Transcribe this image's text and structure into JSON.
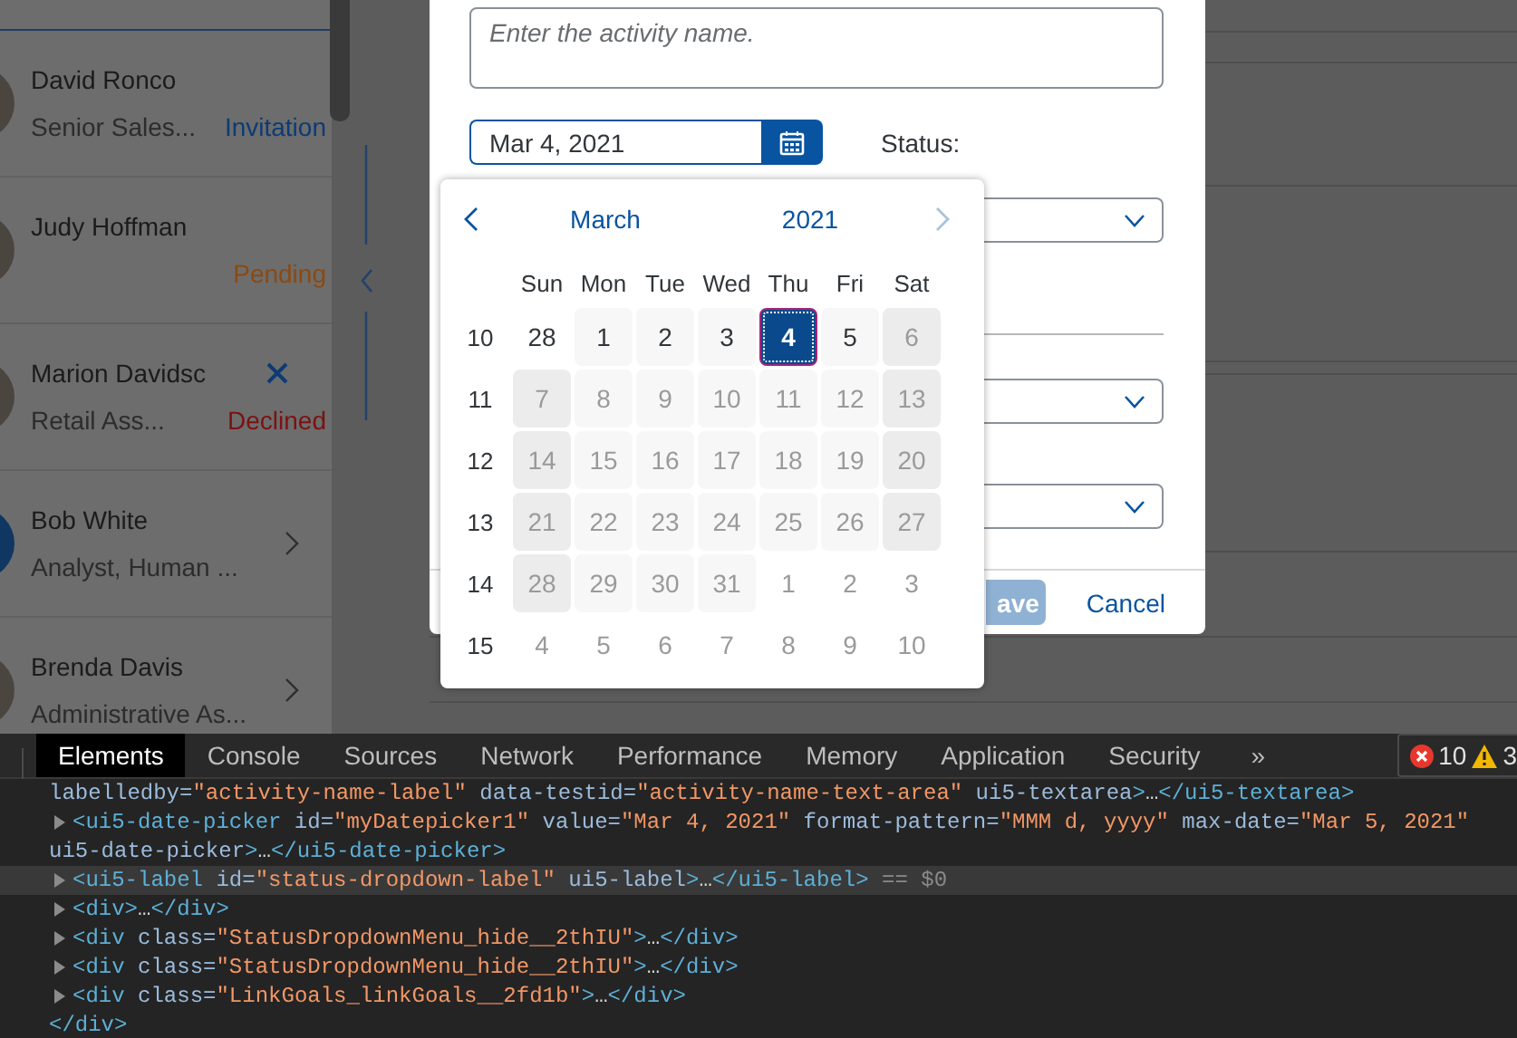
{
  "contacts": [
    {
      "name": "David Ronco",
      "subtitle": "Senior Sales...",
      "kind": "photo",
      "trailing": {
        "kind": "status",
        "text": "Invitation",
        "color": "#0d3b73"
      }
    },
    {
      "name": "Judy Hoffman",
      "kind": "photo",
      "trailing": {
        "kind": "status",
        "text": "Pending",
        "color": "#8a4a12"
      }
    },
    {
      "name": "Marion Davidsc",
      "subtitle": "Retail Ass...",
      "kind": "photo",
      "trailing": {
        "kind": "removable",
        "text": "Declined",
        "color": "#7c1111"
      }
    },
    {
      "name": "Bob White",
      "subtitle": "Analyst, Human ...",
      "kind": "plain",
      "trailing": {
        "kind": "chevron"
      }
    },
    {
      "name": "Brenda Davis",
      "subtitle": "Administrative As...",
      "kind": "photo",
      "trailing": {
        "kind": "chevron"
      }
    }
  ],
  "dialog": {
    "activity_name": {
      "placeholder": "Enter the activity name."
    },
    "date": {
      "value": "Mar 4, 2021"
    },
    "status_label": "Status:",
    "buttons": [
      {
        "label": "ave",
        "kind": "emphasized",
        "disabled": true
      },
      {
        "label": "Cancel",
        "kind": "transparent",
        "disabled": false
      }
    ]
  },
  "calendar": {
    "month": "March",
    "year": "2021",
    "prev_disabled": false,
    "next_disabled": true,
    "weekdays": [
      "Sun",
      "Mon",
      "Tue",
      "Wed",
      "Thu",
      "Fri",
      "Sat"
    ],
    "weeks": [
      {
        "number": "10",
        "days": [
          {
            "text": "28",
            "kind": "other_month",
            "disabled": false,
            "selected": false
          },
          {
            "text": "1",
            "kind": "weekday",
            "disabled": false,
            "selected": false
          },
          {
            "text": "2",
            "kind": "weekday",
            "disabled": false,
            "selected": false
          },
          {
            "text": "3",
            "kind": "weekday",
            "disabled": false,
            "selected": false
          },
          {
            "text": "4",
            "kind": "weekday",
            "disabled": false,
            "selected": true
          },
          {
            "text": "5",
            "kind": "weekday",
            "disabled": false,
            "selected": false
          },
          {
            "text": "6",
            "kind": "weekend",
            "disabled": true,
            "selected": false
          }
        ]
      },
      {
        "number": "11",
        "days": [
          {
            "text": "7",
            "kind": "weekend",
            "disabled": true,
            "selected": false
          },
          {
            "text": "8",
            "kind": "weekday",
            "disabled": true,
            "selected": false
          },
          {
            "text": "9",
            "kind": "weekday",
            "disabled": true,
            "selected": false
          },
          {
            "text": "10",
            "kind": "weekday",
            "disabled": true,
            "selected": false
          },
          {
            "text": "11",
            "kind": "weekday",
            "disabled": true,
            "selected": false
          },
          {
            "text": "12",
            "kind": "weekday",
            "disabled": true,
            "selected": false
          },
          {
            "text": "13",
            "kind": "weekend",
            "disabled": true,
            "selected": false
          }
        ]
      },
      {
        "number": "12",
        "days": [
          {
            "text": "14",
            "kind": "weekend",
            "disabled": true,
            "selected": false
          },
          {
            "text": "15",
            "kind": "weekday",
            "disabled": true,
            "selected": false
          },
          {
            "text": "16",
            "kind": "weekday",
            "disabled": true,
            "selected": false
          },
          {
            "text": "17",
            "kind": "weekday",
            "disabled": true,
            "selected": false
          },
          {
            "text": "18",
            "kind": "weekday",
            "disabled": true,
            "selected": false
          },
          {
            "text": "19",
            "kind": "weekday",
            "disabled": true,
            "selected": false
          },
          {
            "text": "20",
            "kind": "weekend",
            "disabled": true,
            "selected": false
          }
        ]
      },
      {
        "number": "13",
        "days": [
          {
            "text": "21",
            "kind": "weekend",
            "disabled": true,
            "selected": false
          },
          {
            "text": "22",
            "kind": "weekday",
            "disabled": true,
            "selected": false
          },
          {
            "text": "23",
            "kind": "weekday",
            "disabled": true,
            "selected": false
          },
          {
            "text": "24",
            "kind": "weekday",
            "disabled": true,
            "selected": false
          },
          {
            "text": "25",
            "kind": "weekday",
            "disabled": true,
            "selected": false
          },
          {
            "text": "26",
            "kind": "weekday",
            "disabled": true,
            "selected": false
          },
          {
            "text": "27",
            "kind": "weekend",
            "disabled": true,
            "selected": false
          }
        ]
      },
      {
        "number": "14",
        "days": [
          {
            "text": "28",
            "kind": "weekend",
            "disabled": true,
            "selected": false
          },
          {
            "text": "29",
            "kind": "weekday",
            "disabled": true,
            "selected": false
          },
          {
            "text": "30",
            "kind": "weekday",
            "disabled": true,
            "selected": false
          },
          {
            "text": "31",
            "kind": "weekday",
            "disabled": true,
            "selected": false
          },
          {
            "text": "1",
            "kind": "other_month",
            "disabled": true,
            "selected": false
          },
          {
            "text": "2",
            "kind": "other_month",
            "disabled": true,
            "selected": false
          },
          {
            "text": "3",
            "kind": "other_month",
            "disabled": true,
            "selected": false
          }
        ]
      },
      {
        "number": "15",
        "days": [
          {
            "text": "4",
            "kind": "other_month",
            "disabled": true,
            "selected": false
          },
          {
            "text": "5",
            "kind": "other_month",
            "disabled": true,
            "selected": false
          },
          {
            "text": "6",
            "kind": "other_month",
            "disabled": true,
            "selected": false
          },
          {
            "text": "7",
            "kind": "other_month",
            "disabled": true,
            "selected": false
          },
          {
            "text": "8",
            "kind": "other_month",
            "disabled": true,
            "selected": false
          },
          {
            "text": "9",
            "kind": "other_month",
            "disabled": true,
            "selected": false
          },
          {
            "text": "10",
            "kind": "other_month",
            "disabled": true,
            "selected": false
          }
        ]
      }
    ]
  },
  "devtools": {
    "tabs": [
      {
        "label": "Elements",
        "selected": true
      },
      {
        "label": "Console",
        "selected": false
      },
      {
        "label": "Sources",
        "selected": false
      },
      {
        "label": "Network",
        "selected": false
      },
      {
        "label": "Performance",
        "selected": false
      },
      {
        "label": "Memory",
        "selected": false
      },
      {
        "label": "Application",
        "selected": false
      },
      {
        "label": "Security",
        "selected": false
      }
    ],
    "overflow": "»",
    "errors": "10",
    "warnings": "3",
    "lines": [
      {
        "kind": "continuation",
        "selected": false,
        "tokens": [
          {
            "kind": "attr",
            "text": "labelledby="
          },
          {
            "kind": "value",
            "text": "\"activity-name-label\""
          },
          {
            "kind": "attr",
            "text": " data-testid="
          },
          {
            "kind": "value",
            "text": "\"activity-name-text-area\""
          },
          {
            "kind": "attr",
            "text": " ui5-textarea"
          },
          {
            "kind": "tag",
            "text": ">"
          },
          {
            "kind": "text",
            "text": "…"
          },
          {
            "kind": "tag",
            "text": "</ui5-textarea>"
          }
        ]
      },
      {
        "kind": "node",
        "expanded": false,
        "selected": false,
        "tokens": [
          {
            "kind": "tag",
            "text": "<ui5-date-picker"
          },
          {
            "kind": "attr",
            "text": " id="
          },
          {
            "kind": "value",
            "text": "\"myDatepicker1\""
          },
          {
            "kind": "attr",
            "text": " value="
          },
          {
            "kind": "value",
            "text": "\"Mar 4, 2021\""
          },
          {
            "kind": "attr",
            "text": " format-pattern="
          },
          {
            "kind": "value",
            "text": "\"MMM d, yyyy\""
          },
          {
            "kind": "attr",
            "text": " max-date="
          },
          {
            "kind": "value",
            "text": "\"Mar 5, 2021\""
          }
        ]
      },
      {
        "kind": "continuation",
        "selected": false,
        "tokens": [
          {
            "kind": "attr",
            "text": "ui5-date-picker"
          },
          {
            "kind": "tag",
            "text": ">"
          },
          {
            "kind": "text",
            "text": "…"
          },
          {
            "kind": "tag",
            "text": "</ui5-date-picker>"
          }
        ]
      },
      {
        "kind": "node",
        "expanded": false,
        "selected": true,
        "tokens": [
          {
            "kind": "tag",
            "text": "<ui5-label"
          },
          {
            "kind": "attr",
            "text": " id="
          },
          {
            "kind": "value",
            "text": "\"status-dropdown-label\""
          },
          {
            "kind": "attr",
            "text": " ui5-label"
          },
          {
            "kind": "tag",
            "text": ">"
          },
          {
            "kind": "text",
            "text": "…"
          },
          {
            "kind": "tag",
            "text": "</ui5-label>"
          },
          {
            "kind": "hint",
            "text": " == $0"
          }
        ]
      },
      {
        "kind": "node",
        "expanded": false,
        "selected": false,
        "tokens": [
          {
            "kind": "tag",
            "text": "<div>"
          },
          {
            "kind": "text",
            "text": "…"
          },
          {
            "kind": "tag",
            "text": "</div>"
          }
        ]
      },
      {
        "kind": "node",
        "expanded": false,
        "selected": false,
        "tokens": [
          {
            "kind": "tag",
            "text": "<div"
          },
          {
            "kind": "attr",
            "text": " class="
          },
          {
            "kind": "value",
            "text": "\"StatusDropdownMenu_hide__2thIU\""
          },
          {
            "kind": "tag",
            "text": ">"
          },
          {
            "kind": "text",
            "text": "…"
          },
          {
            "kind": "tag",
            "text": "</div>"
          }
        ]
      },
      {
        "kind": "node",
        "expanded": false,
        "selected": false,
        "tokens": [
          {
            "kind": "tag",
            "text": "<div"
          },
          {
            "kind": "attr",
            "text": " class="
          },
          {
            "kind": "value",
            "text": "\"StatusDropdownMenu_hide__2thIU\""
          },
          {
            "kind": "tag",
            "text": ">"
          },
          {
            "kind": "text",
            "text": "…"
          },
          {
            "kind": "tag",
            "text": "</div>"
          }
        ]
      },
      {
        "kind": "node",
        "expanded": false,
        "selected": false,
        "tokens": [
          {
            "kind": "tag",
            "text": "<div"
          },
          {
            "kind": "attr",
            "text": " class="
          },
          {
            "kind": "value",
            "text": "\"LinkGoals_linkGoals__2fd1b\""
          },
          {
            "kind": "tag",
            "text": ">"
          },
          {
            "kind": "text",
            "text": "…"
          },
          {
            "kind": "tag",
            "text": "</div>"
          }
        ]
      },
      {
        "kind": "continuation",
        "selected": false,
        "tokens": [
          {
            "kind": "tag",
            "text": "</div>"
          }
        ]
      }
    ]
  }
}
